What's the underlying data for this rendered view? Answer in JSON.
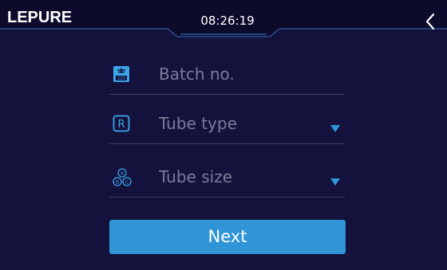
{
  "header": {
    "brand": "LEPURE",
    "time": "08:26:19",
    "back_icon": "chevron-left-icon"
  },
  "form": {
    "batch": {
      "label": "Batch no.",
      "icon": "batch-number-icon"
    },
    "tube_type": {
      "label": "Tube type",
      "icon": "r-letter-icon",
      "dropdown_icon": "caret-down-icon"
    },
    "tube_size": {
      "label": "Tube size",
      "icon": "abc-circles-icon",
      "dropdown_icon": "caret-down-icon"
    }
  },
  "next_button": {
    "label": "Next"
  },
  "colors": {
    "background": "#14123d",
    "accent": "#2f95d6",
    "icon_blue": "#3aa6e8",
    "divider": "#3d3b68",
    "placeholder": "#7a7b98"
  }
}
